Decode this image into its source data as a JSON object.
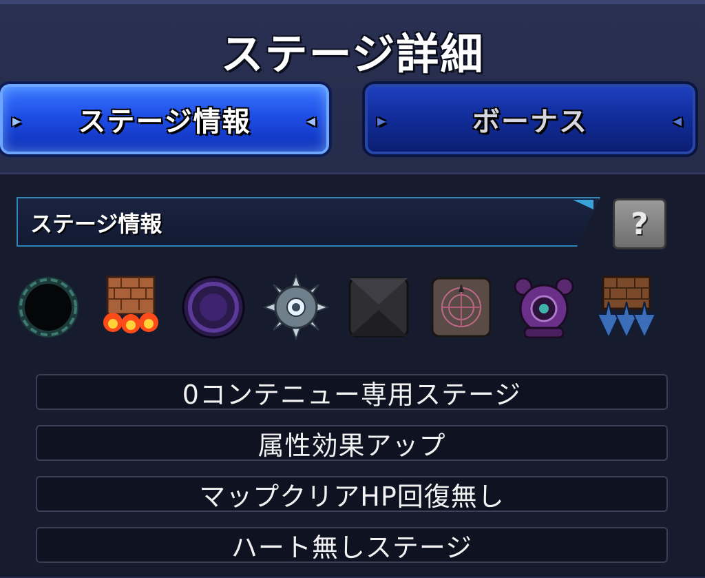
{
  "title": "ステージ詳細",
  "tabs": [
    {
      "label": "ステージ情報",
      "active": true
    },
    {
      "label": "ボーナス",
      "active": false
    }
  ],
  "info_section": {
    "label": "ステージ情報",
    "help_icon": "question-mark-icon"
  },
  "gimmicks": [
    {
      "name": "black-hole-icon"
    },
    {
      "name": "damage-wall-fire-icon"
    },
    {
      "name": "warp-vortex-icon"
    },
    {
      "name": "spiked-mine-icon"
    },
    {
      "name": "dark-block-icon"
    },
    {
      "name": "magic-circle-panel-icon"
    },
    {
      "name": "shield-generator-icon"
    },
    {
      "name": "damage-wall-down-arrows-icon"
    }
  ],
  "rules": [
    "0コンテニュー専用ステージ",
    "属性効果アップ",
    "マップクリアHP回復無し",
    "ハート無しステージ"
  ],
  "colors": {
    "tab_active": "#2a5cf0",
    "tab_inactive": "#12309c",
    "panel": "#171b2e",
    "accent_cyan": "#2d86b8"
  }
}
